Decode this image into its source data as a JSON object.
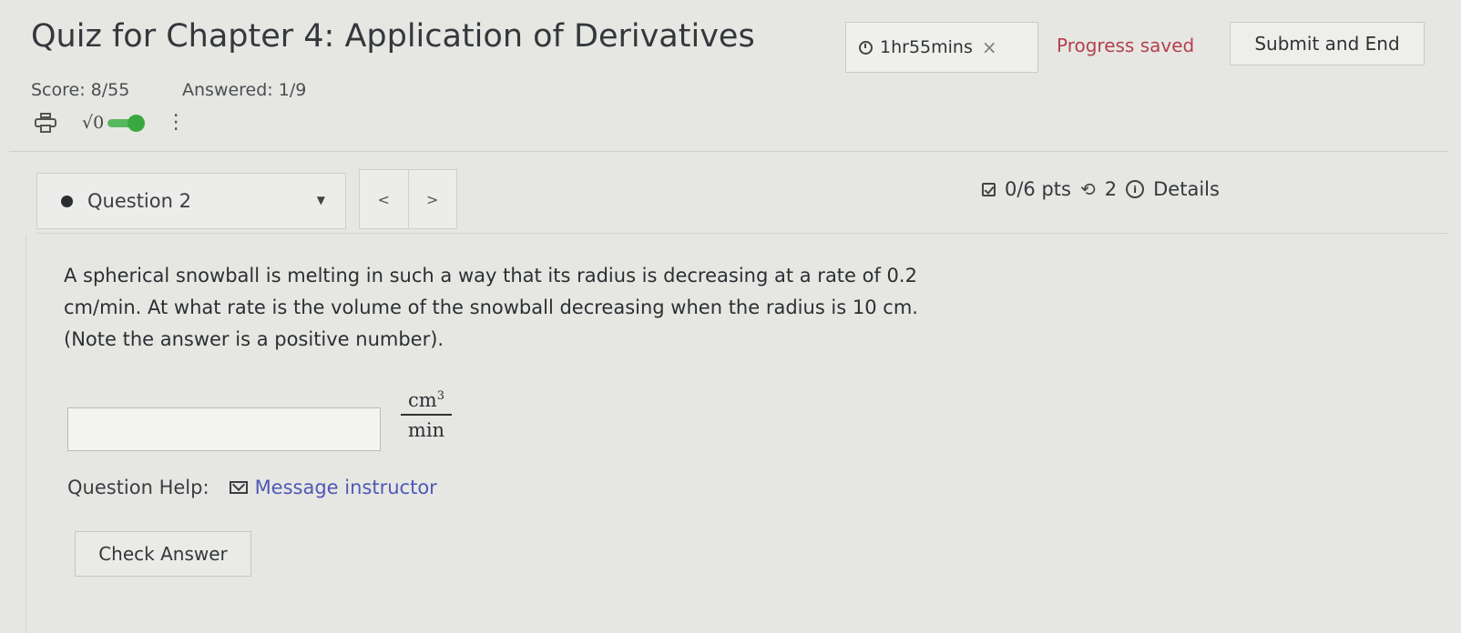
{
  "header": {
    "title": "Quiz for Chapter 4: Application of Derivatives",
    "timer": "1hr55mins",
    "timer_close": "×",
    "progress": "Progress saved",
    "submit_label": "Submit and End"
  },
  "status": {
    "score": "Score: 8/55",
    "answered": "Answered: 1/9"
  },
  "toolbar": {
    "math_label": "√0",
    "icons": [
      "printer-icon",
      "math-input-icon",
      "toggle-switch",
      "kebab-menu-icon"
    ],
    "toggle_color": "#39a93f"
  },
  "question_nav": {
    "selector_label": "Question 2",
    "prev": "<",
    "next": ">",
    "points": "0/6 pts",
    "retries": "2",
    "details": "Details"
  },
  "question": {
    "line1": "A spherical snowball is melting in such a way that its radius is decreasing at a rate of 0.2",
    "line2": "cm/min. At what rate is the volume of the snowball decreasing when the radius is 10 cm.",
    "line3": "(Note the answer is a positive number).",
    "unit_num": "cm",
    "unit_exp": "3",
    "unit_den": "min",
    "answer_value": ""
  },
  "help": {
    "label": "Question Help:",
    "link": "Message instructor"
  },
  "check_label": "Check Answer",
  "colors": {
    "progress_text": "#b5404f",
    "link": "#4f58b4",
    "background": "#e6e7e3"
  }
}
